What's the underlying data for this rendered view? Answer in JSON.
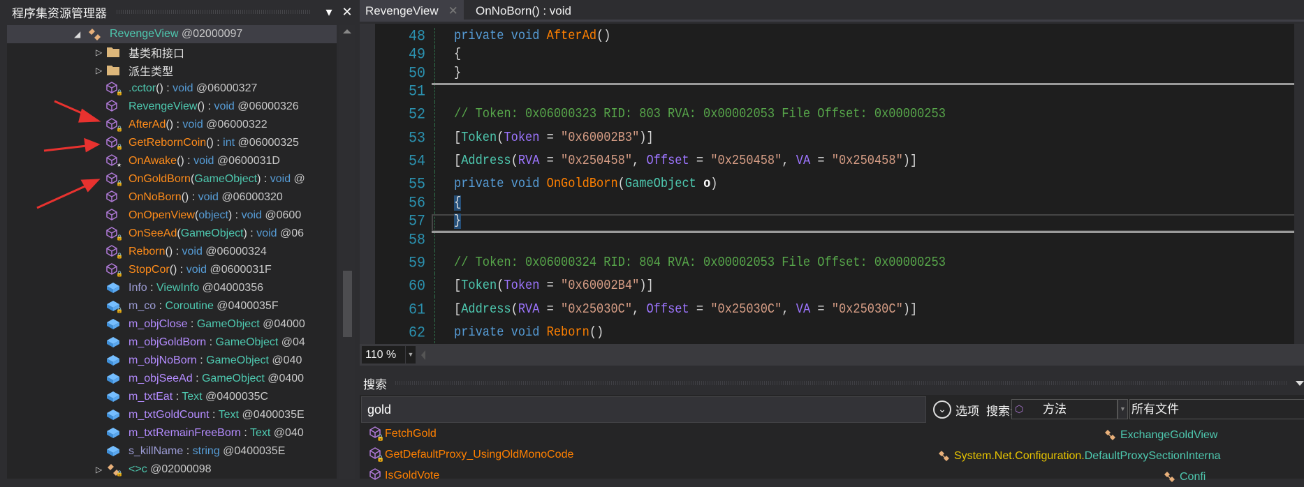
{
  "left_panel": {
    "title": "程序集资源管理器",
    "menu_icon": "dropdown-triangle-icon",
    "close_icon": "close-icon",
    "tree": [
      {
        "level": 0,
        "expander": "expanded",
        "icon": "class",
        "selected": true,
        "segments": [
          {
            "t": "RevengeView",
            "k": "type"
          },
          {
            "t": " @02000097",
            "k": "addr"
          }
        ]
      },
      {
        "level": 1,
        "expander": "collapsed",
        "icon": "folder",
        "segments": [
          {
            "t": "基类和接口",
            "k": "plain"
          }
        ]
      },
      {
        "level": 1,
        "expander": "collapsed",
        "icon": "folder",
        "segments": [
          {
            "t": "派生类型",
            "k": "plain"
          }
        ]
      },
      {
        "level": 1,
        "icon": "method",
        "lock": true,
        "segments": [
          {
            "t": ".cctor",
            "k": "type"
          },
          {
            "t": "() : ",
            "k": "punc"
          },
          {
            "t": "void",
            "k": "kw"
          },
          {
            "t": " @06000327",
            "k": "addr"
          }
        ]
      },
      {
        "level": 1,
        "icon": "method",
        "segments": [
          {
            "t": "RevengeView",
            "k": "type"
          },
          {
            "t": "() : ",
            "k": "punc"
          },
          {
            "t": "void",
            "k": "kw"
          },
          {
            "t": " @06000326",
            "k": "addr"
          }
        ]
      },
      {
        "level": 1,
        "icon": "method",
        "lock": true,
        "segments": [
          {
            "t": "AfterAd",
            "k": "method"
          },
          {
            "t": "() : ",
            "k": "punc"
          },
          {
            "t": "void",
            "k": "kw"
          },
          {
            "t": " @06000322",
            "k": "addr"
          }
        ]
      },
      {
        "level": 1,
        "icon": "method",
        "lock": true,
        "segments": [
          {
            "t": "GetRebornCoin",
            "k": "method"
          },
          {
            "t": "() : ",
            "k": "punc"
          },
          {
            "t": "int",
            "k": "kw"
          },
          {
            "t": " @06000325",
            "k": "addr"
          }
        ]
      },
      {
        "level": 1,
        "icon": "method",
        "star": true,
        "segments": [
          {
            "t": "OnAwake",
            "k": "method"
          },
          {
            "t": "() : ",
            "k": "punc"
          },
          {
            "t": "void",
            "k": "kw"
          },
          {
            "t": " @0600031D",
            "k": "addr"
          }
        ]
      },
      {
        "level": 1,
        "icon": "method",
        "lock": true,
        "segments": [
          {
            "t": "OnGoldBorn",
            "k": "method"
          },
          {
            "t": "(",
            "k": "punc"
          },
          {
            "t": "GameObject",
            "k": "type"
          },
          {
            "t": ") : ",
            "k": "punc"
          },
          {
            "t": "void",
            "k": "kw"
          },
          {
            "t": " @",
            "k": "addr"
          }
        ]
      },
      {
        "level": 1,
        "icon": "method",
        "segments": [
          {
            "t": "OnNoBorn",
            "k": "method"
          },
          {
            "t": "() : ",
            "k": "punc"
          },
          {
            "t": "void",
            "k": "kw"
          },
          {
            "t": " @06000320",
            "k": "addr"
          }
        ]
      },
      {
        "level": 1,
        "icon": "method",
        "segments": [
          {
            "t": "OnOpenView",
            "k": "method"
          },
          {
            "t": "(",
            "k": "punc"
          },
          {
            "t": "object",
            "k": "kw"
          },
          {
            "t": ") : ",
            "k": "punc"
          },
          {
            "t": "void",
            "k": "kw"
          },
          {
            "t": " @0600",
            "k": "addr"
          }
        ]
      },
      {
        "level": 1,
        "icon": "method",
        "lock": true,
        "segments": [
          {
            "t": "OnSeeAd",
            "k": "method"
          },
          {
            "t": "(",
            "k": "punc"
          },
          {
            "t": "GameObject",
            "k": "type"
          },
          {
            "t": ") : ",
            "k": "punc"
          },
          {
            "t": "void",
            "k": "kw"
          },
          {
            "t": " @06",
            "k": "addr"
          }
        ]
      },
      {
        "level": 1,
        "icon": "method",
        "lock": true,
        "segments": [
          {
            "t": "Reborn",
            "k": "method"
          },
          {
            "t": "() : ",
            "k": "punc"
          },
          {
            "t": "void",
            "k": "kw"
          },
          {
            "t": " @06000324",
            "k": "addr"
          }
        ]
      },
      {
        "level": 1,
        "icon": "method",
        "lock": true,
        "segments": [
          {
            "t": "StopCor",
            "k": "method"
          },
          {
            "t": "() : ",
            "k": "punc"
          },
          {
            "t": "void",
            "k": "kw"
          },
          {
            "t": " @0600031F",
            "k": "addr"
          }
        ]
      },
      {
        "level": 1,
        "icon": "field",
        "segments": [
          {
            "t": "Info",
            "k": "sfield"
          },
          {
            "t": " : ",
            "k": "punc"
          },
          {
            "t": "ViewInfo",
            "k": "type"
          },
          {
            "t": " @04000356",
            "k": "addr"
          }
        ]
      },
      {
        "level": 1,
        "icon": "field",
        "lock": true,
        "segments": [
          {
            "t": "m_co",
            "k": "sfield"
          },
          {
            "t": " : ",
            "k": "punc"
          },
          {
            "t": "Coroutine",
            "k": "type"
          },
          {
            "t": " @0400035F",
            "k": "addr"
          }
        ]
      },
      {
        "level": 1,
        "icon": "field",
        "segments": [
          {
            "t": "m_objClose",
            "k": "field"
          },
          {
            "t": " : ",
            "k": "punc"
          },
          {
            "t": "GameObject",
            "k": "type"
          },
          {
            "t": " @04000",
            "k": "addr"
          }
        ]
      },
      {
        "level": 1,
        "icon": "field",
        "segments": [
          {
            "t": "m_objGoldBorn",
            "k": "field"
          },
          {
            "t": " : ",
            "k": "punc"
          },
          {
            "t": "GameObject",
            "k": "type"
          },
          {
            "t": " @04",
            "k": "addr"
          }
        ]
      },
      {
        "level": 1,
        "icon": "field",
        "segments": [
          {
            "t": "m_objNoBorn",
            "k": "field"
          },
          {
            "t": " : ",
            "k": "punc"
          },
          {
            "t": "GameObject",
            "k": "type"
          },
          {
            "t": " @040",
            "k": "addr"
          }
        ]
      },
      {
        "level": 1,
        "icon": "field",
        "segments": [
          {
            "t": "m_objSeeAd",
            "k": "field"
          },
          {
            "t": " : ",
            "k": "punc"
          },
          {
            "t": "GameObject",
            "k": "type"
          },
          {
            "t": " @0400",
            "k": "addr"
          }
        ]
      },
      {
        "level": 1,
        "icon": "field",
        "segments": [
          {
            "t": "m_txtEat",
            "k": "field"
          },
          {
            "t": " : ",
            "k": "punc"
          },
          {
            "t": "Text",
            "k": "type"
          },
          {
            "t": " @0400035C",
            "k": "addr"
          }
        ]
      },
      {
        "level": 1,
        "icon": "field",
        "segments": [
          {
            "t": "m_txtGoldCount",
            "k": "field"
          },
          {
            "t": " : ",
            "k": "punc"
          },
          {
            "t": "Text",
            "k": "type"
          },
          {
            "t": " @0400035E",
            "k": "addr"
          }
        ]
      },
      {
        "level": 1,
        "icon": "field",
        "segments": [
          {
            "t": "m_txtRemainFreeBorn",
            "k": "field"
          },
          {
            "t": " : ",
            "k": "punc"
          },
          {
            "t": "Text",
            "k": "type"
          },
          {
            "t": " @040",
            "k": "addr"
          }
        ]
      },
      {
        "level": 1,
        "icon": "field",
        "segments": [
          {
            "t": "s_killName",
            "k": "sfield"
          },
          {
            "t": " : ",
            "k": "punc"
          },
          {
            "t": "string",
            "k": "kw"
          },
          {
            "t": " @0400035E",
            "k": "addr"
          }
        ]
      },
      {
        "level": 1,
        "expander": "collapsed",
        "icon": "class",
        "lock": true,
        "segments": [
          {
            "t": "<>c",
            "k": "type"
          },
          {
            "t": " @02000098",
            "k": "addr"
          }
        ]
      }
    ],
    "annotation_color": "#e8322f"
  },
  "tabs": [
    {
      "label": "RevengeView",
      "active": true,
      "close_icon": "close-icon"
    },
    {
      "label": "OnNoBorn() : void",
      "active": false
    }
  ],
  "editor": {
    "lines": [
      {
        "n": "48",
        "tokens": [
          [
            "private void ",
            "kw"
          ],
          [
            "AfterAd",
            "method"
          ],
          [
            "()",
            "punc"
          ]
        ]
      },
      {
        "n": "49",
        "tokens": [
          [
            "{",
            "punc"
          ]
        ]
      },
      {
        "n": "50",
        "tokens": [
          [
            "}",
            "punc"
          ]
        ]
      },
      {
        "n": "51",
        "tokens": [],
        "separator": true
      },
      {
        "n": "52",
        "tokens": [
          [
            "// Token: 0x06000323 RID: 803 RVA: 0x00002053 File Offset: 0x00000253",
            "cmt"
          ]
        ]
      },
      {
        "n": "53",
        "tokens": [
          [
            "[",
            "punc"
          ],
          [
            "Token",
            "type"
          ],
          [
            "(",
            "punc"
          ],
          [
            "Token",
            "prop"
          ],
          [
            " = ",
            "punc"
          ],
          [
            "\"0x60002B3\"",
            "str"
          ],
          [
            ")]",
            "punc"
          ]
        ]
      },
      {
        "n": "54",
        "tokens": [
          [
            "[",
            "punc"
          ],
          [
            "Address",
            "type"
          ],
          [
            "(",
            "punc"
          ],
          [
            "RVA",
            "prop"
          ],
          [
            " = ",
            "punc"
          ],
          [
            "\"0x250458\"",
            "str"
          ],
          [
            ", ",
            "punc"
          ],
          [
            "Offset",
            "prop"
          ],
          [
            " = ",
            "punc"
          ],
          [
            "\"0x250458\"",
            "str"
          ],
          [
            ", ",
            "punc"
          ],
          [
            "VA",
            "prop"
          ],
          [
            " = ",
            "punc"
          ],
          [
            "\"0x250458\"",
            "str"
          ],
          [
            ")]",
            "punc"
          ]
        ]
      },
      {
        "n": "55",
        "tokens": [
          [
            "private void ",
            "kw"
          ],
          [
            "OnGoldBorn",
            "method"
          ],
          [
            "(",
            "punc"
          ],
          [
            "GameObject",
            "type"
          ],
          [
            " ",
            "punc"
          ],
          [
            "o",
            "param"
          ],
          [
            ")",
            "punc"
          ]
        ]
      },
      {
        "n": "56",
        "tokens": [
          [
            "{",
            "hl"
          ]
        ]
      },
      {
        "n": "57",
        "tokens": [
          [
            "}",
            "hl"
          ]
        ],
        "current": true
      },
      {
        "n": "58",
        "tokens": [],
        "separator": true
      },
      {
        "n": "59",
        "tokens": [
          [
            "// Token: 0x06000324 RID: 804 RVA: 0x00002053 File Offset: 0x00000253",
            "cmt"
          ]
        ]
      },
      {
        "n": "60",
        "tokens": [
          [
            "[",
            "punc"
          ],
          [
            "Token",
            "type"
          ],
          [
            "(",
            "punc"
          ],
          [
            "Token",
            "prop"
          ],
          [
            " = ",
            "punc"
          ],
          [
            "\"0x60002B4\"",
            "str"
          ],
          [
            ")]",
            "punc"
          ]
        ]
      },
      {
        "n": "61",
        "tokens": [
          [
            "[",
            "punc"
          ],
          [
            "Address",
            "type"
          ],
          [
            "(",
            "punc"
          ],
          [
            "RVA",
            "prop"
          ],
          [
            " = ",
            "punc"
          ],
          [
            "\"0x25030C\"",
            "str"
          ],
          [
            ", ",
            "punc"
          ],
          [
            "Offset",
            "prop"
          ],
          [
            " = ",
            "punc"
          ],
          [
            "\"0x25030C\"",
            "str"
          ],
          [
            ", ",
            "punc"
          ],
          [
            "VA",
            "prop"
          ],
          [
            " = ",
            "punc"
          ],
          [
            "\"0x25030C\"",
            "str"
          ],
          [
            ")]",
            "punc"
          ]
        ]
      },
      {
        "n": "62",
        "tokens": [
          [
            "private void ",
            "kw"
          ],
          [
            "Reborn",
            "method"
          ],
          [
            "()",
            "punc"
          ]
        ]
      }
    ],
    "zoom": "110 %"
  },
  "search": {
    "title": "搜索",
    "query": "gold",
    "options_label": "选项",
    "search_label": "搜索:",
    "kind": "方法",
    "scope": "所有文件",
    "results": [
      {
        "name": "FetchGold",
        "lock": true,
        "container": [
          {
            "t": "ExchangeGoldView",
            "k": "type"
          }
        ]
      },
      {
        "name": "GetDefaultProxy_UsingOldMonoCode",
        "lock": true,
        "container": [
          {
            "t": "System.Net.Configuration.",
            "k": "ns"
          },
          {
            "t": "DefaultProxySectionInterna",
            "k": "type"
          }
        ]
      },
      {
        "name": "IsGoldVote",
        "lock": false,
        "container": [
          {
            "t": "Confi",
            "k": "type"
          }
        ]
      }
    ]
  }
}
